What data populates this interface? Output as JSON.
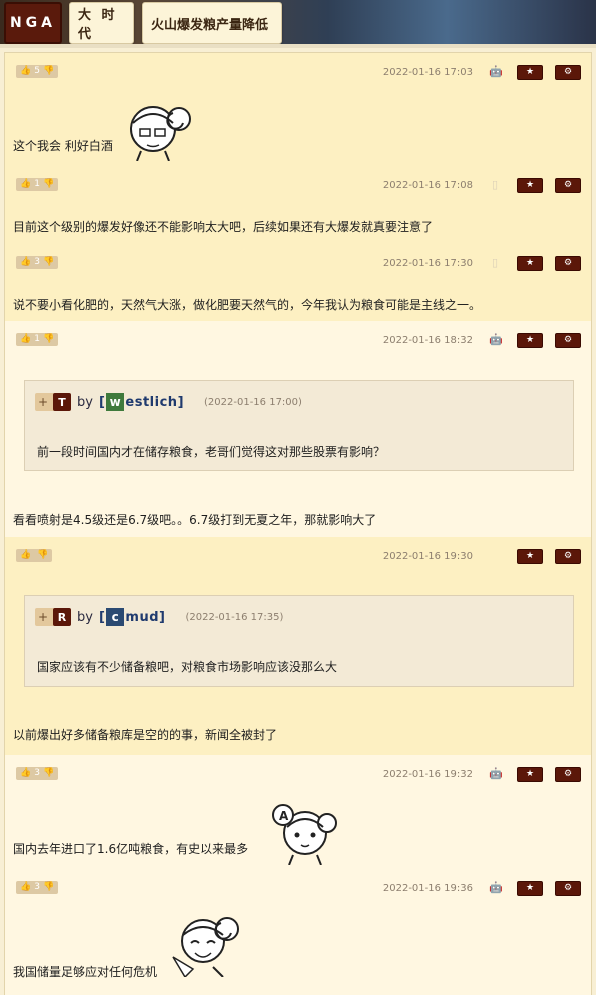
{
  "header": {
    "logo": "NGA",
    "crumbs": [
      "大 时 代",
      "火山爆发粮产量降低"
    ]
  },
  "posts": [
    {
      "likes": "5",
      "date": "2022-01-16 17:03",
      "device": "android-icon",
      "content": "这个我会 利好白酒"
    },
    {
      "likes": "1",
      "date": "2022-01-16 17:08",
      "device": "phone-icon",
      "content": "目前这个级别的爆发好像还不能影响太大吧，后续如果还有大爆发就真要注意了"
    },
    {
      "likes": "3",
      "date": "2022-01-16 17:30",
      "device": "phone-icon",
      "content": "说不要小看化肥的，天然气大涨，做化肥要天然气的，今年我认为粮食可能是主线之一。"
    },
    {
      "likes": "1",
      "date": "2022-01-16 18:32",
      "device": "android-icon",
      "quote": {
        "letter": "T",
        "by": "by",
        "initial": "w",
        "name_rest": "estlich",
        "date": "(2022-01-16 17:00)",
        "text": "前一段时间国内才在储存粮食，老哥们觉得这对那些股票有影响？"
      },
      "content": "看看喷射是4.5级还是6.7级吧。。6.7级打到无夏之年，那就影响大了"
    },
    {
      "likes": "",
      "date": "2022-01-16 19:30",
      "device": "apple-icon",
      "quote": {
        "letter": "R",
        "by": "by",
        "initial": "c",
        "name_rest": "mud",
        "date": "(2022-01-16 17:35)",
        "text": "国家应该有不少储备粮吧，对粮食市场影响应该没那么大"
      },
      "content": "以前爆出好多储备粮库是空的的事，新闻全被封了"
    },
    {
      "likes": "3",
      "date": "2022-01-16 19:32",
      "device": "android-icon",
      "content": "国内去年进口了1.6亿吨粮食，有史以来最多"
    },
    {
      "likes": "3",
      "date": "2022-01-16 19:36",
      "device": "android-icon",
      "content": "我国储量足够应对任何危机"
    }
  ],
  "colors": {
    "accent": "#5b1709",
    "bg": "#fdf3d9",
    "alt": "#fff7e1"
  }
}
